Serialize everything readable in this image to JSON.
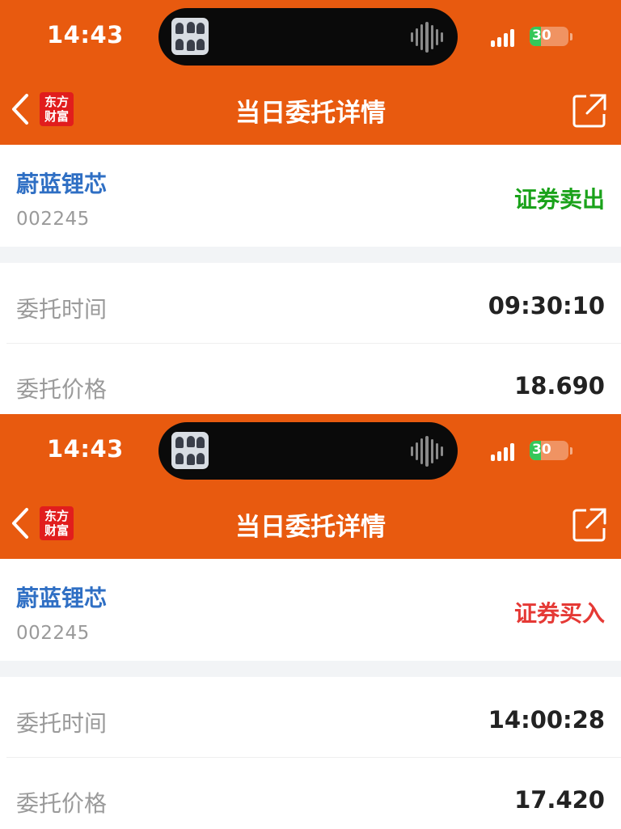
{
  "colors": {
    "header_bg": "#e85a0f",
    "stock_name": "#2f6fc4",
    "sell": "#1aa21a",
    "buy": "#e53935",
    "label": "#9a9a9a",
    "value": "#222222"
  },
  "icons": {
    "back": "chevron-left-icon",
    "share": "share-external-icon",
    "wave": "audio-wave-icon",
    "signal": "cellular-signal-icon",
    "battery": "battery-icon"
  },
  "panels": [
    {
      "status_bar": {
        "time": "14:43",
        "battery": "30"
      },
      "logo": {
        "line1": "东方",
        "line2": "财富"
      },
      "title": "当日委托详情",
      "stock": {
        "name": "蔚蓝锂芯",
        "code": "002245"
      },
      "direction": {
        "label": "证券卖出",
        "color": "#1aa21a"
      },
      "rows": [
        {
          "label": "委托时间",
          "value": "09:30:10"
        },
        {
          "label": "委托价格",
          "value": "18.690"
        }
      ]
    },
    {
      "status_bar": {
        "time": "14:43",
        "battery": "30"
      },
      "logo": {
        "line1": "东方",
        "line2": "财富"
      },
      "title": "当日委托详情",
      "stock": {
        "name": "蔚蓝锂芯",
        "code": "002245"
      },
      "direction": {
        "label": "证券买入",
        "color": "#e53935"
      },
      "rows": [
        {
          "label": "委托时间",
          "value": "14:00:28"
        },
        {
          "label": "委托价格",
          "value": "17.420"
        }
      ]
    }
  ]
}
